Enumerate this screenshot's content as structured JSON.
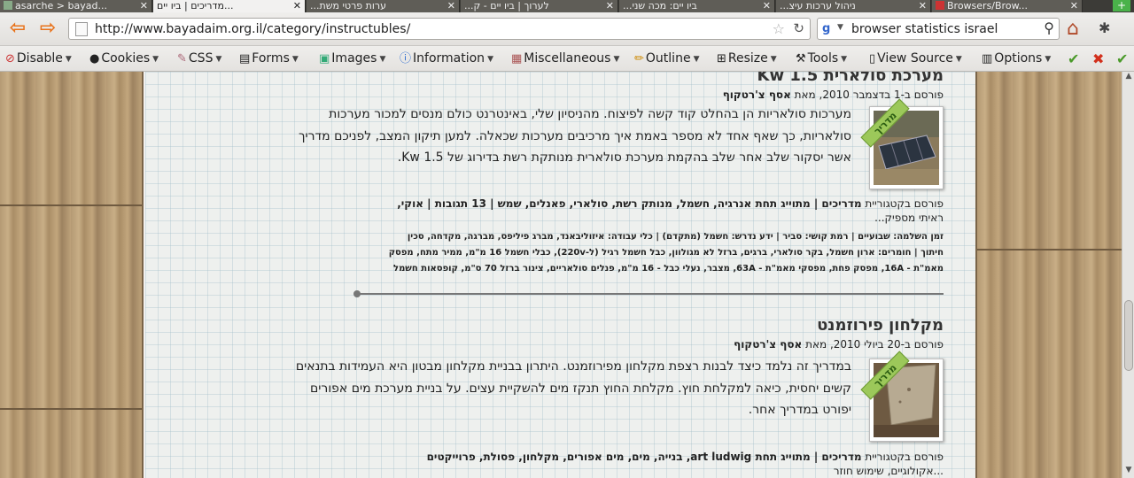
{
  "tabs": [
    {
      "label": "asarche > bayad...",
      "active": false
    },
    {
      "label": "מדריכים | ביו יים...",
      "active": true
    },
    {
      "label": "...ערות פרטי משת",
      "active": false
    },
    {
      "label": "...לערוך | ביו יים - ק",
      "active": false
    },
    {
      "label": "...ביו יים: מכה שני",
      "active": false
    },
    {
      "label": "...ניהול ערכות עיצ",
      "active": false
    },
    {
      "label": "Browsers/Brow...",
      "active": false
    }
  ],
  "navbar": {
    "url": "http://www.bayadaim.org.il/category/instructubles/",
    "search_query": "browser statistics israel"
  },
  "devbar": {
    "items": [
      "Disable",
      "Cookies",
      "CSS",
      "Forms",
      "Images",
      "Information",
      "Miscellaneous",
      "Outline",
      "Resize",
      "Tools",
      "View Source",
      "Options"
    ]
  },
  "posts": [
    {
      "title": "מערכת סולארית 1.5 Kw",
      "meta_prefix": "פורסם ב-1 בדצמבר 2010, מאת ",
      "author": "אסף צ'רטקוף",
      "ribbon": "מדריך",
      "excerpt": "מערכות סולאריות הן בהחלט קוד קשה לפיצוח. מהניסיון שלי, באינטרנט כולם מנסים למכור מערכות סולאריות, כך שאף אחד לא מספר באמת איך מרכיבים מערכות שכאלה. למען תיקון המצב, לפניכם מדריך אשר יסקור שלב אחר שלב בהקמת מערכת סולארית מנותקת רשת בדירוג של 1.5 Kw.",
      "cats_prefix": "פורסם בקטגוריית ",
      "cats_bold": "מדריכים | מתוייג תחת אנרגיה, חשמל, מנותק רשת, סולארי, פאנלים, שמש | 13 תגובות | אוקי,",
      "cats_more": "ראיתי מספיק...",
      "details": [
        "זמן השלמה: שבועיים | רמת קושי: סביר | ידע נדרש: חשמל (מתקדם) | כלי עבודה: איזוליבאנד, מברג פיליפס, מברגה, מקדחה, סכין",
        "חיתוך | חומרים: ארון חשמל, בקר סולארי, ברגים, ברזל לא מגולוון, כבל חשמל רגיל (ל-220v), כבלי חשמל 16 מ\"מ, ממיר מתח, מפסק",
        "מאמ\"ת - 16A, מפסק פחת, מפסקי מאמ\"ת - 63A, מצבר, נעלי כבל - 16 מ\"מ, פנלים סולאריים, צינור ברזל 70 ס\"מ, קופסאות חשמל"
      ]
    },
    {
      "title": "מקלחון פירוזמנט",
      "meta_prefix": "פורסם ב-20 ביולי 2010, מאת ",
      "author": "אסף צ'רטקוף",
      "ribbon": "מדריך",
      "excerpt": "במדריך זה נלמד כיצד לבנות רצפת מקלחון מפירוזמנט. היתרון בבניית מקלחון מבטון היא העמידות בתנאים קשים יחסית, כיאה למקלחת חוץ. מקלחת החוץ תנקז מים להשקיית עצים. על בניית מערכת מים אפורים יפורט במדריך אחר.",
      "cats_prefix": "פורסם בקטגוריית ",
      "cats_bold": "מדריכים | מתוייג תחת art ludwig, בנייה, מים, מים אפורים, מקלחון, פסולת, פרוייקטים",
      "cats_more": "...אקולוגיים, שימוש חוזר"
    }
  ]
}
